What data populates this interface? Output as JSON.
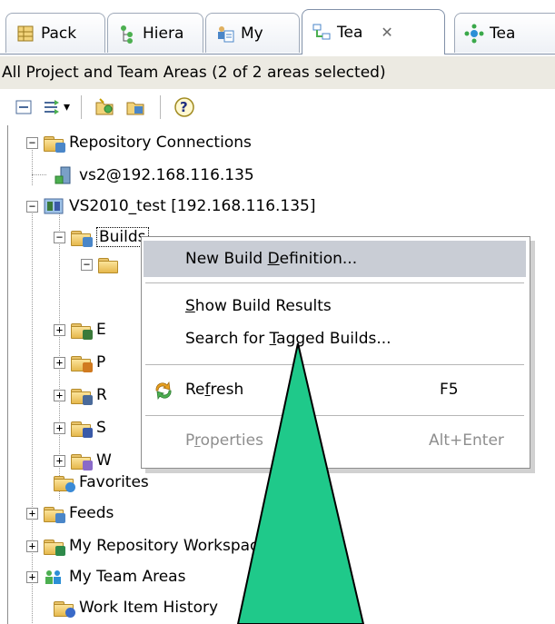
{
  "tabs": [
    {
      "label": "Pack",
      "icon": "package-explorer-icon"
    },
    {
      "label": "Hiera",
      "icon": "hierarchy-icon"
    },
    {
      "label": "My",
      "icon": "my-work-icon"
    },
    {
      "label": "Tea",
      "icon": "team-artifacts-icon",
      "active": true,
      "close": "✕"
    },
    {
      "label": "Tea",
      "icon": "team-organization-icon"
    }
  ],
  "header": {
    "text": "All Project and Team Areas (2 of 2 areas selected)"
  },
  "toolbar": {
    "collapse_all": "collapse-all-icon",
    "filter": "filter-icon",
    "dropdown": "▾",
    "connect": "connect-repository-icon",
    "manage": "manage-connections-icon",
    "help": "help-icon"
  },
  "tree": {
    "repository_connections": "Repository Connections",
    "connection": "vs2@192.168.116.135",
    "project": "VS2010_test [192.168.116.135]",
    "builds": "Builds",
    "favorites": "Favorites",
    "feeds": "Feeds",
    "my_repository_workspaces": "My Repository Workspaces",
    "my_team_areas": "My Team Areas",
    "work_item_history": "Work Item History",
    "partial": {
      "e": "E",
      "p": "P",
      "r": "R",
      "s": "S",
      "w": "W"
    },
    "expand_minus": "−",
    "expand_plus": "+"
  },
  "menu": {
    "new_build_definition": {
      "pre": "New Build ",
      "u": "D",
      "post": "efinition..."
    },
    "show_build_results": {
      "pre": "",
      "u": "S",
      "post": "how Build Results"
    },
    "search_tagged": {
      "pre": "Search for ",
      "u": "T",
      "post": "agged Builds..."
    },
    "refresh": {
      "pre": "Re",
      "u": "f",
      "post": "resh",
      "shortcut": "F5"
    },
    "properties": {
      "pre": "P",
      "u": "r",
      "post": "operties",
      "shortcut": "Alt+Enter"
    }
  }
}
